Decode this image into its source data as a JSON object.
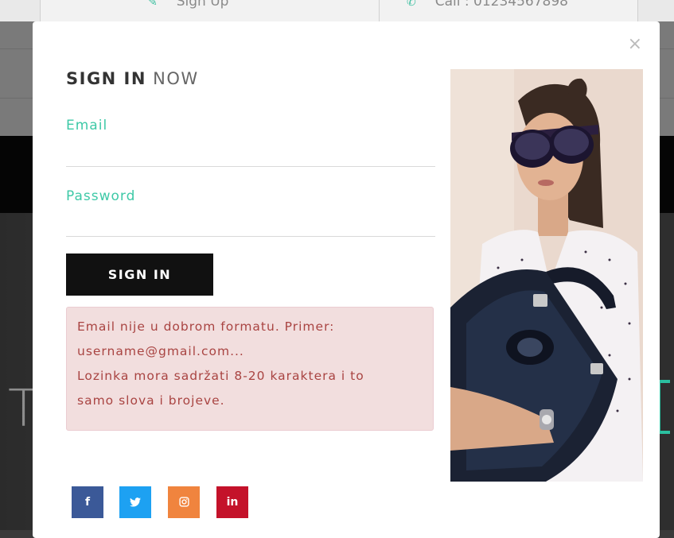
{
  "topbar": {
    "signup_label": "Sign Up",
    "call_label": "Call : 01234567898"
  },
  "background": {
    "hero_letter": "T"
  },
  "modal": {
    "close_label": "×",
    "title_bold": "SIGN IN",
    "title_light": "NOW",
    "email_label": "Email",
    "email_value": "",
    "password_label": "Password",
    "password_value": "",
    "signin_button": "SIGN IN",
    "errors": [
      "Email nije u dobrom formatu. Primer:",
      "username@gmail.com...",
      "Lozinka mora sadržati 8-20 karaktera i to",
      "samo slova i brojeve."
    ],
    "image_alt": "Woman with sunglasses holding a black handbag"
  },
  "social": {
    "facebook": "f",
    "twitter": "🐦",
    "instagram": "◎",
    "linkedin": "in"
  },
  "colors": {
    "accent": "#3ec9a7",
    "error_bg": "#f2dede",
    "error_text": "#a94442",
    "button_bg": "#111111"
  }
}
